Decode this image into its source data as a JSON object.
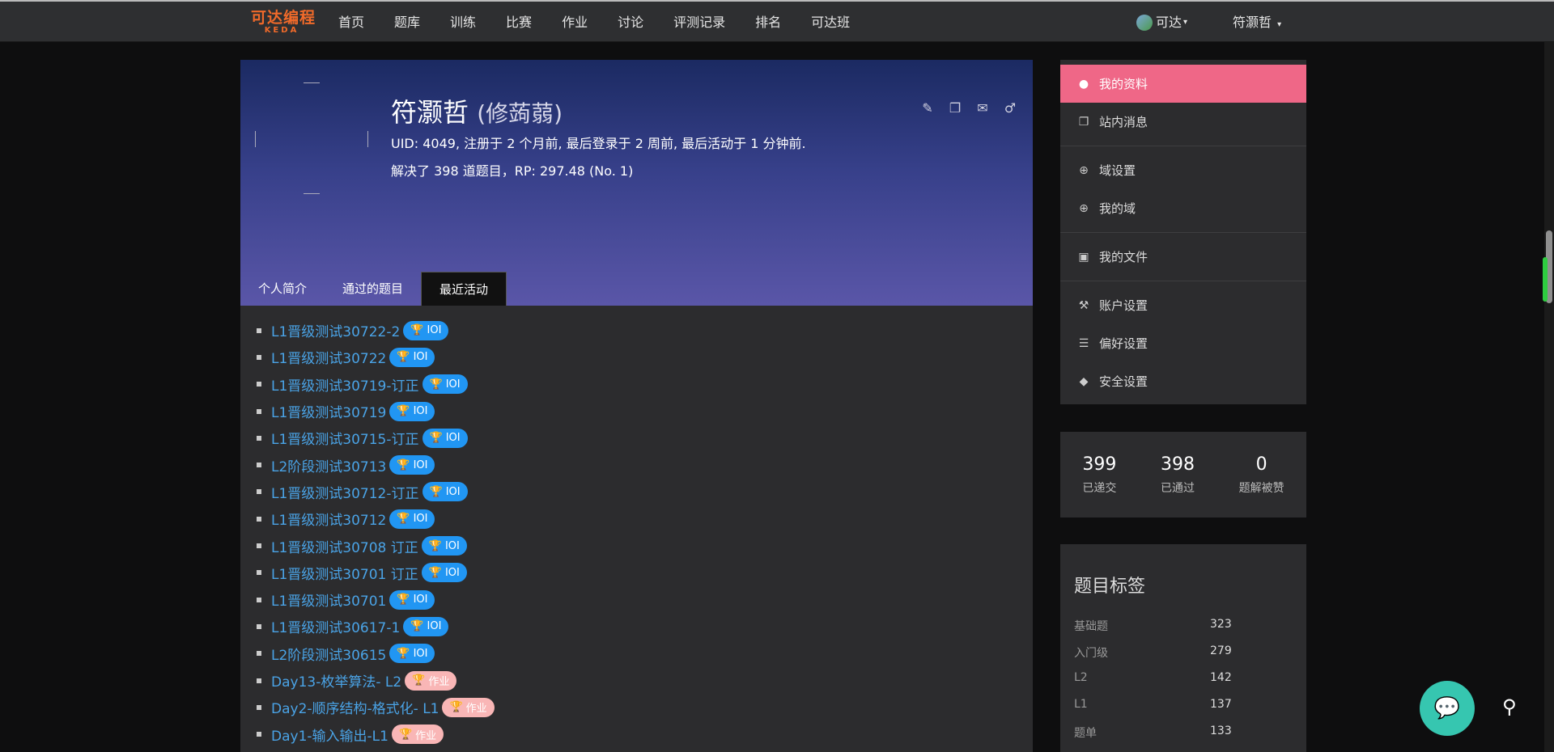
{
  "nav": {
    "logo_main": "可达编程",
    "logo_sub": "KEDA",
    "links": [
      "首页",
      "题库",
      "训练",
      "比赛",
      "作业",
      "讨论",
      "评测记录",
      "排名",
      "可达班"
    ],
    "domain": "可达",
    "user": "符灏哲"
  },
  "profile": {
    "name": "符灏哲",
    "alias": "(修蒟蒻)",
    "info": "UID: 4049, 注册于 2 个月前, 最后登录于 2 周前, 最后活动于 1 分钟前.",
    "solved": "解决了 398 道题目，RP: 297.48 (No. 1)",
    "icons": [
      "edit-icon",
      "copy-icon",
      "mail-icon",
      "male-icon"
    ],
    "tabs": [
      "个人简介",
      "通过的题目",
      "最近活动"
    ]
  },
  "activities": [
    {
      "title": "L1晋级测试30722-2",
      "badge": "IOI",
      "type": "ioi"
    },
    {
      "title": "L1晋级测试30722",
      "badge": "IOI",
      "type": "ioi"
    },
    {
      "title": "L1晋级测试30719-订正",
      "badge": "IOI",
      "type": "ioi"
    },
    {
      "title": "L1晋级测试30719",
      "badge": "IOI",
      "type": "ioi"
    },
    {
      "title": "L1晋级测试30715-订正",
      "badge": "IOI",
      "type": "ioi"
    },
    {
      "title": "L2阶段测试30713",
      "badge": "IOI",
      "type": "ioi"
    },
    {
      "title": "L1晋级测试30712-订正",
      "badge": "IOI",
      "type": "ioi"
    },
    {
      "title": "L1晋级测试30712",
      "badge": "IOI",
      "type": "ioi"
    },
    {
      "title": "L1晋级测试30708 订正",
      "badge": "IOI",
      "type": "ioi"
    },
    {
      "title": "L1晋级测试30701 订正",
      "badge": "IOI",
      "type": "ioi"
    },
    {
      "title": "L1晋级测试30701",
      "badge": "IOI",
      "type": "ioi"
    },
    {
      "title": "L1晋级测试30617-1",
      "badge": "IOI",
      "type": "ioi"
    },
    {
      "title": "L2阶段测试30615",
      "badge": "IOI",
      "type": "ioi"
    },
    {
      "title": "Day13-枚举算法- L2",
      "badge": "作业",
      "type": "hw"
    },
    {
      "title": "Day2-顺序结构-格式化- L1",
      "badge": "作业",
      "type": "hw"
    },
    {
      "title": "Day1-输入输出-L1",
      "badge": "作业",
      "type": "hw"
    }
  ],
  "sidebar": {
    "items": [
      {
        "label": "我的资料",
        "icon": "user-circle-icon"
      },
      {
        "label": "站内消息",
        "icon": "message-icon"
      },
      {
        "label": "域设置",
        "icon": "globe-icon"
      },
      {
        "label": "我的域",
        "icon": "globe-icon"
      },
      {
        "label": "我的文件",
        "icon": "file-image-icon"
      },
      {
        "label": "账户设置",
        "icon": "wrench-icon"
      },
      {
        "label": "偏好设置",
        "icon": "sliders-icon"
      },
      {
        "label": "安全设置",
        "icon": "shield-icon"
      }
    ]
  },
  "stats": [
    {
      "value": "399",
      "label": "已递交"
    },
    {
      "value": "398",
      "label": "已通过"
    },
    {
      "value": "0",
      "label": "题解被赞"
    }
  ],
  "tags": {
    "title": "题目标签",
    "rows": [
      {
        "name": "基础题",
        "count": "323"
      },
      {
        "name": "入门级",
        "count": "279"
      },
      {
        "name": "L2",
        "count": "142"
      },
      {
        "name": "L1",
        "count": "137"
      },
      {
        "name": "题单",
        "count": "133"
      }
    ]
  },
  "colors": {
    "accent": "#ef6787",
    "link": "#4aa3e6",
    "ioi_badge": "#2196f3",
    "hw_badge": "#f9b6b6",
    "chat": "#36c6b0"
  }
}
